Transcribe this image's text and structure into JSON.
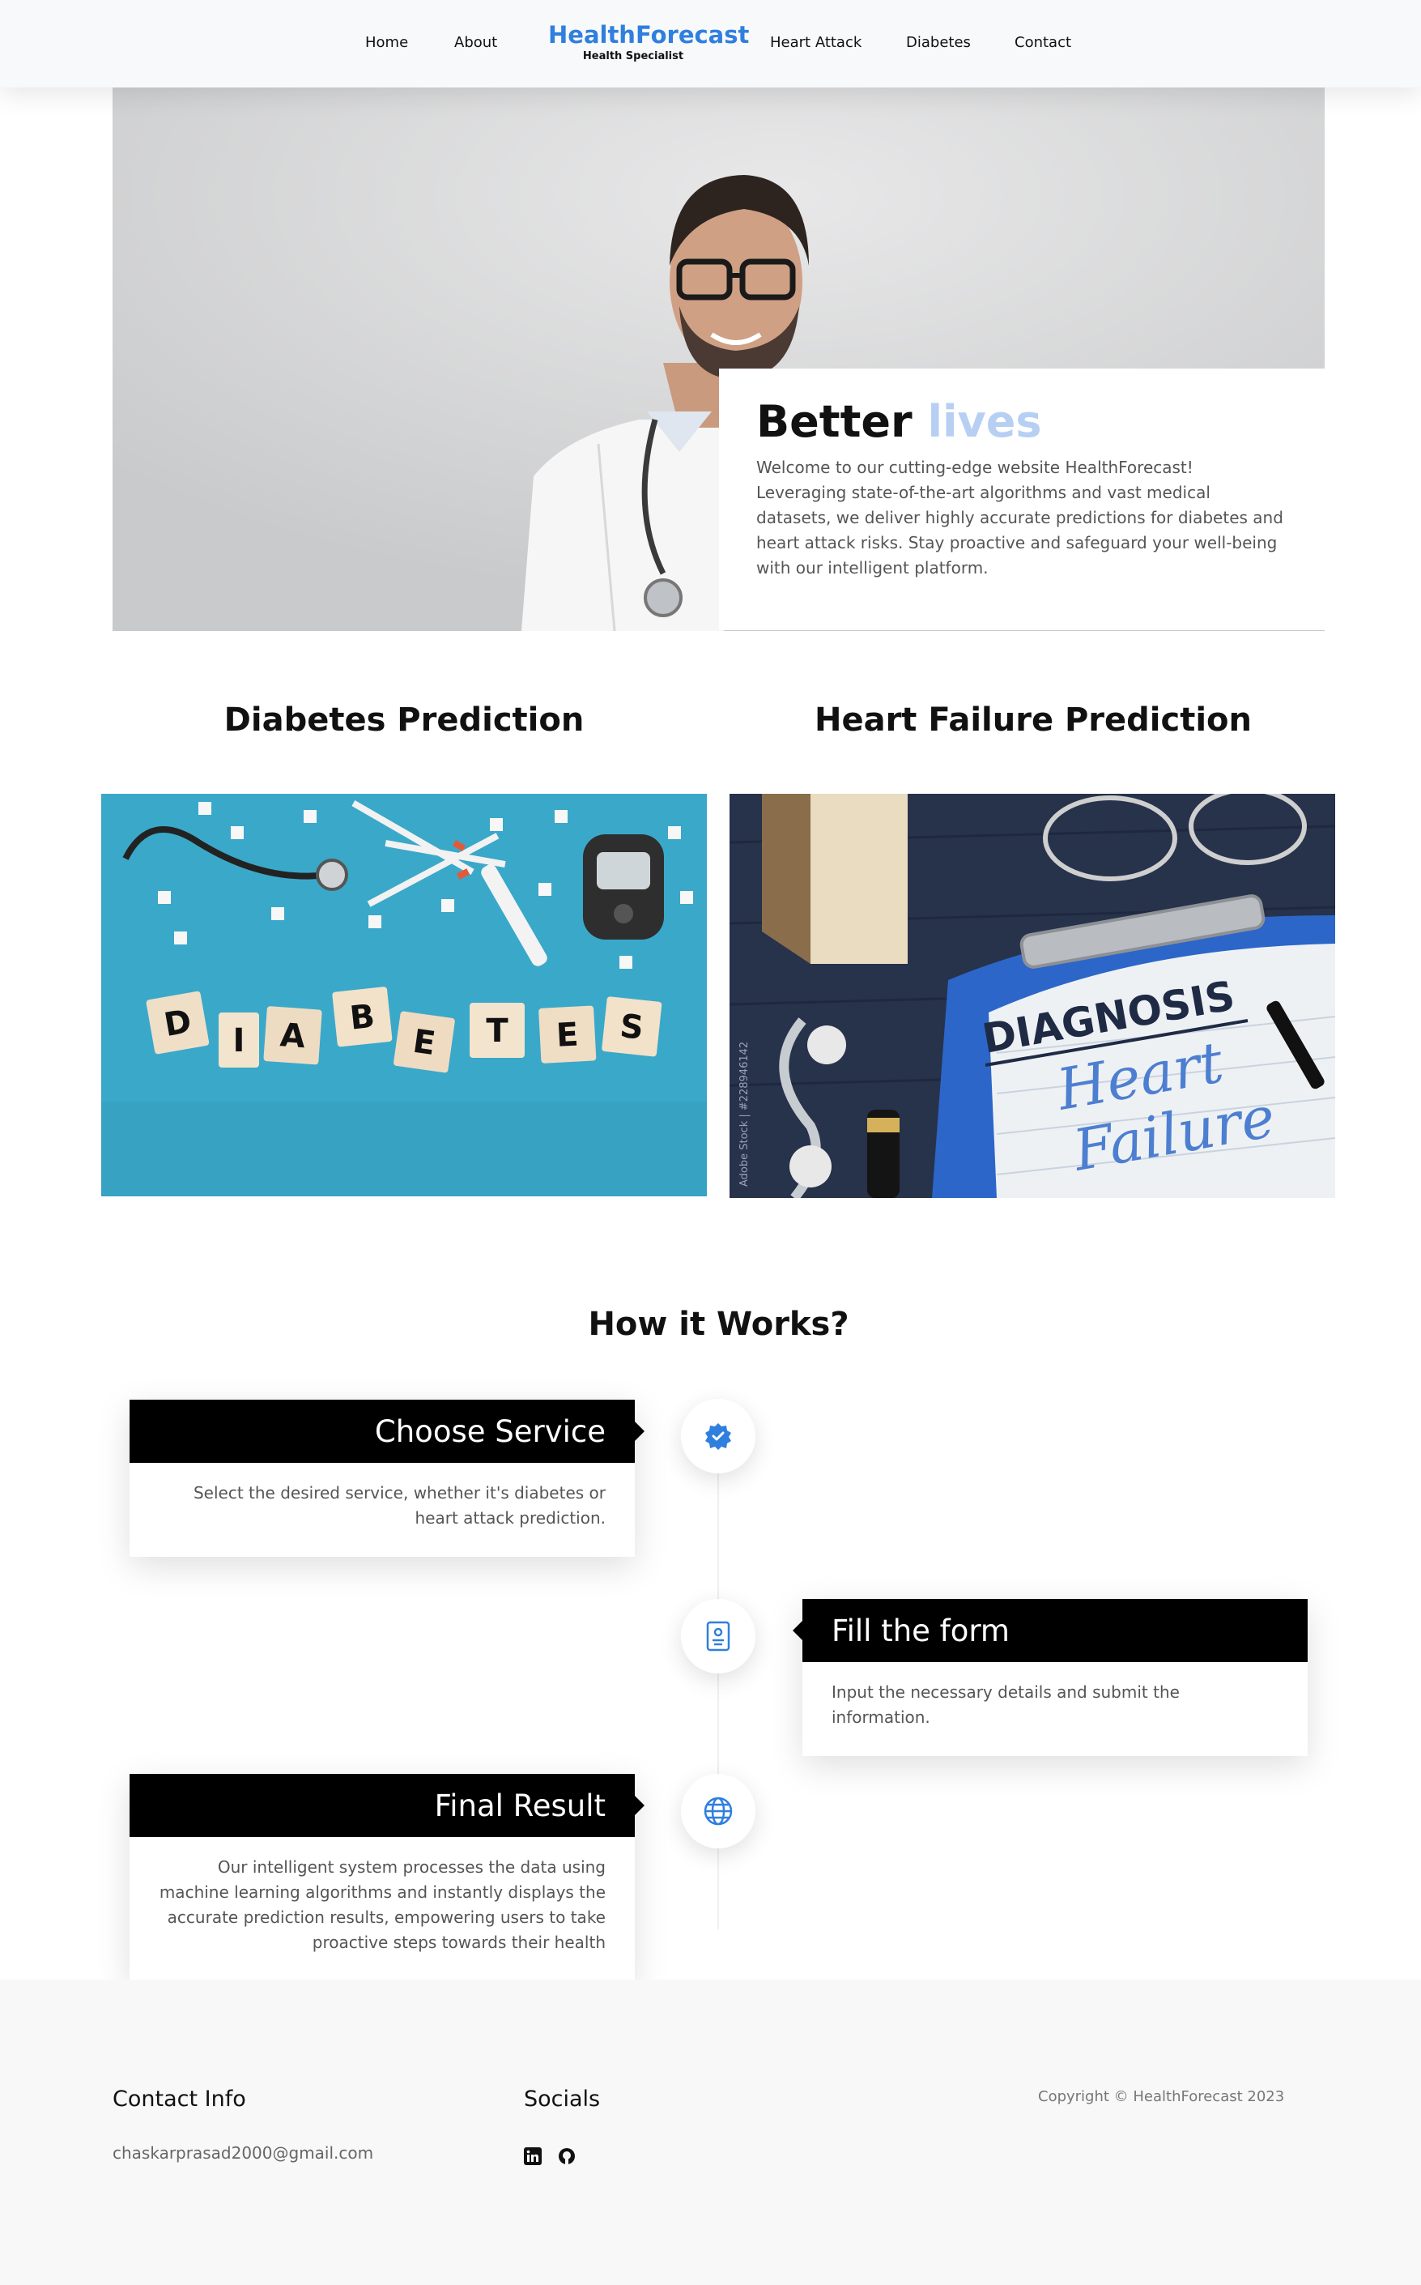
{
  "nav": {
    "home": "Home",
    "about": "About",
    "brand_title": "HealthForecast",
    "brand_subtitle": "Health Specialist",
    "heart_attack": "Heart Attack",
    "diabetes": "Diabetes",
    "contact": "Contact"
  },
  "hero": {
    "title_main": "Better",
    "title_accent": "lives",
    "description": "Welcome to our cutting-edge website HealthForecast! Leveraging state-of-the-art algorithms and vast medical datasets, we deliver highly accurate predictions for diabetes and heart attack risks. Stay proactive and safeguard your well-being with our intelligent platform."
  },
  "predictions": {
    "diabetes_title": "Diabetes Prediction",
    "heart_title": "Heart Failure Prediction",
    "diabetes_tiles": [
      "D",
      "I",
      "A",
      "B",
      "E",
      "T",
      "E",
      "S"
    ],
    "heart_clipboard_heading": "DIAGNOSIS",
    "heart_clipboard_line1": "Heart",
    "heart_clipboard_line2": "Failure",
    "heart_watermark": "Adobe Stock | #228946142"
  },
  "how": {
    "title": "How it Works?",
    "steps": [
      {
        "title": "Choose Service",
        "text": "Select the desired service, whether it's diabetes or heart attack prediction."
      },
      {
        "title": "Fill the form",
        "text": "Input the necessary details and submit the information."
      },
      {
        "title": "Final Result",
        "text": "Our intelligent system processes the data using machine learning algorithms and instantly displays the accurate prediction results, empowering users to take proactive steps towards their health"
      }
    ]
  },
  "footer": {
    "contact_heading": "Contact Info",
    "email": "chaskarprasad2000@gmail.com",
    "socials_heading": "Socials",
    "copyright": "Copyright © HealthForecast 2023"
  },
  "colors": {
    "brand": "#2f7fde",
    "accent_light": "#b6cff3",
    "step_header": "#000000",
    "diabetes_bg": "#3aa7c9",
    "heart_bg": "#2a3550"
  },
  "icons": {
    "step1": "verified-badge-icon",
    "step2": "id-card-icon",
    "step3": "globe-icon",
    "social1": "linkedin-icon",
    "social2": "github-icon"
  }
}
